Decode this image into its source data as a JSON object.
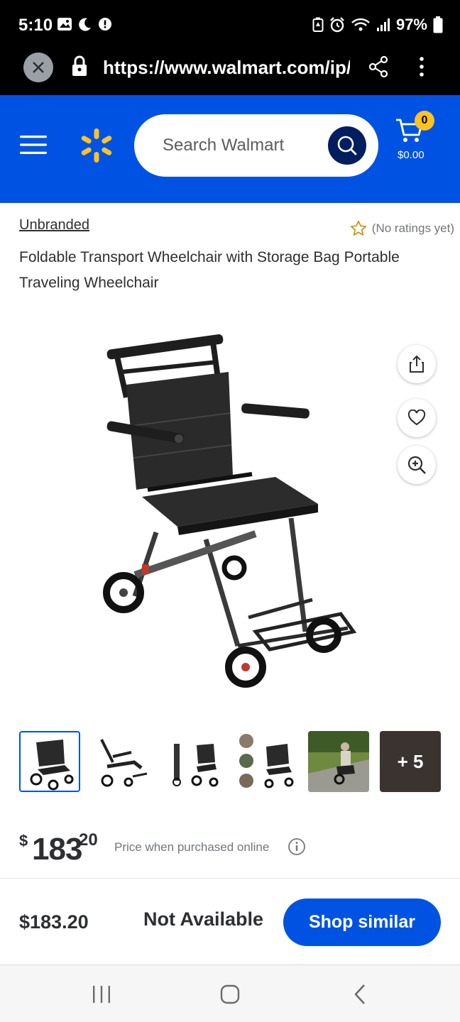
{
  "status_bar": {
    "time": "5:10",
    "battery": "97%",
    "icons": [
      "gallery-icon",
      "moon-icon",
      "alert-icon",
      "battery-saver-icon",
      "alarm-icon",
      "wifi-icon",
      "signal-icon",
      "battery-icon"
    ]
  },
  "browser": {
    "url": "https://www.walmart.com/ip/",
    "icons": [
      "close-icon",
      "lock-icon",
      "share-icon",
      "more-vert-icon"
    ]
  },
  "header": {
    "search_placeholder": "Search Walmart",
    "cart_count": "0",
    "cart_total": "$0.00",
    "colors": {
      "brand_blue": "#0053e2",
      "spark_yellow": "#ffc220",
      "search_button": "#001e60"
    }
  },
  "product": {
    "brand": "Unbranded",
    "rating_text": "(No ratings yet)",
    "title": "Foldable Transport Wheelchair with Storage Bag Portable Traveling Wheelchair",
    "image_name": "wheelchair-product-image",
    "thumbnails_more": "+ 5",
    "price_symbol": "$",
    "price_whole": "183",
    "price_cents": "20",
    "price_note": "Price when purchased online"
  },
  "footer": {
    "price": "$183.20",
    "availability": "Not Available",
    "shop_similar": "Shop similar"
  },
  "nav": {
    "icons": [
      "recent-apps-icon",
      "home-icon",
      "back-icon"
    ]
  }
}
